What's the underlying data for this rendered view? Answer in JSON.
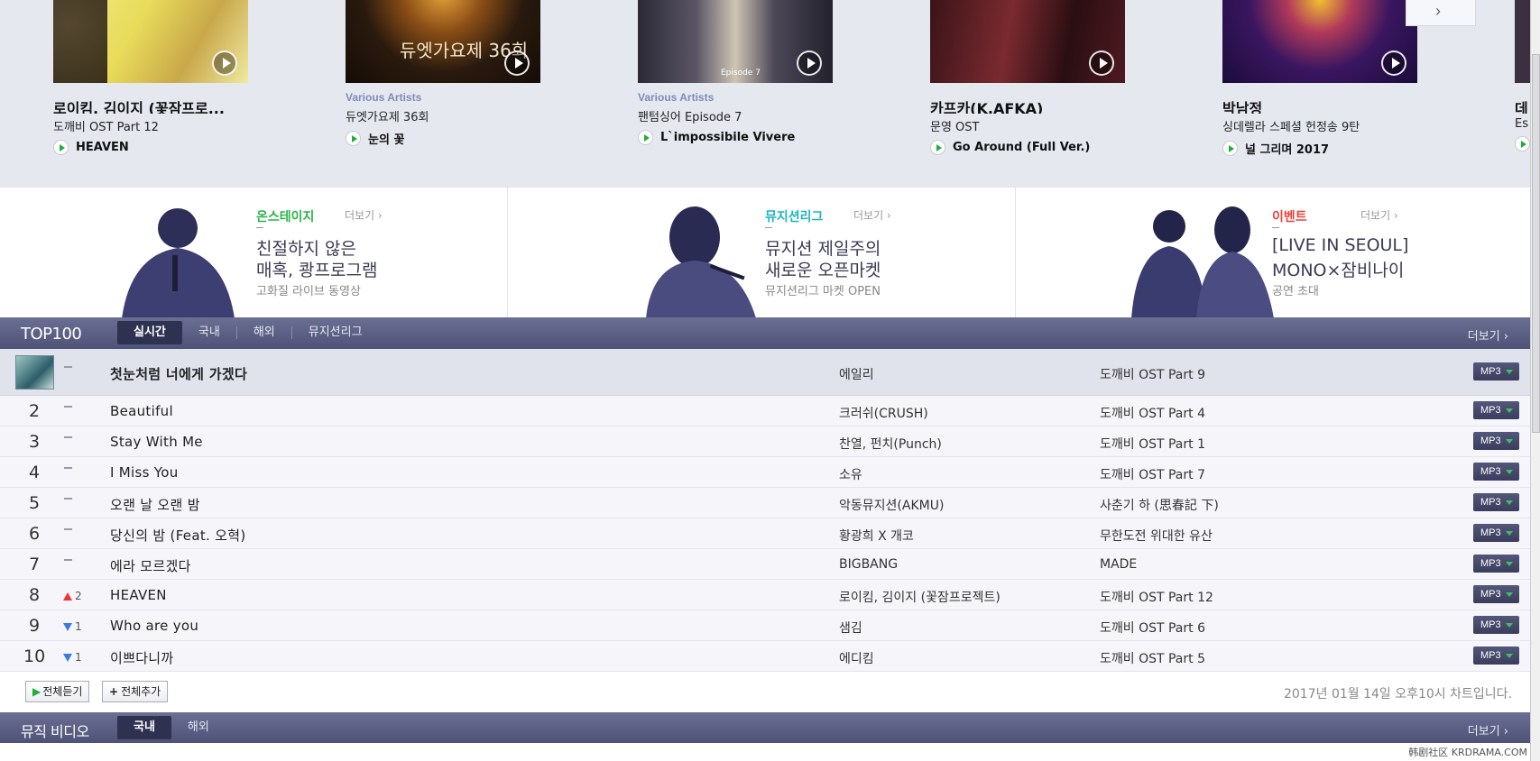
{
  "albums": [
    {
      "artist_small": "",
      "artist_big": "로이킴, 김이지 (꽃잠프로...",
      "sub": "도깨비 OST Part 12",
      "track": "HEAVEN",
      "cover_caption": ""
    },
    {
      "artist_small": "Various Artists",
      "artist_big": "",
      "sub": "듀엣가요제 36회",
      "track": "눈의 꽃",
      "cover_caption": "듀엣가요제 36회"
    },
    {
      "artist_small": "Various Artists",
      "artist_big": "",
      "sub": "팬텀싱어 Episode 7",
      "track": "L`impossibile Vivere",
      "cover_caption": "Episode 7"
    },
    {
      "artist_small": "",
      "artist_big": "카프카(K.AFKA)",
      "sub": "문영 OST",
      "track": "Go Around (Full Ver.)",
      "cover_caption": ""
    },
    {
      "artist_small": "",
      "artist_big": "박남정",
      "sub": "싱데렐라 스페셜 헌정송 9탄",
      "track": "널 그리며 2017",
      "cover_caption": ""
    },
    {
      "artist_small": "",
      "artist_big": "데",
      "sub": "Es",
      "track": "",
      "cover_caption": ""
    }
  ],
  "banners": [
    {
      "category": "온스테이지",
      "more": "더보기 ›",
      "line1": "친절하지 않은",
      "line2": "매혹, 쾅프로그램",
      "desc": "고화질 라이브 동영상",
      "color": "#2bb34a"
    },
    {
      "category": "뮤지션리그",
      "more": "더보기 ›",
      "line1": "뮤지션 제일주의",
      "line2": "새로운 오픈마켓",
      "desc": "뮤지션리그 마켓 OPEN",
      "color": "#1cb6c2"
    },
    {
      "category": "이벤트",
      "more": "더보기 ›",
      "line1": "[LIVE IN SEOUL]",
      "line2": "MONO×잠비나이",
      "desc": "공연 초대",
      "color": "#e8433c"
    }
  ],
  "top100": {
    "title": "TOP100",
    "tabs": [
      "실시간",
      "국내",
      "해외",
      "뮤지션리그"
    ],
    "active_tab": "실시간",
    "more": "더보기 ›"
  },
  "chart_rows": [
    {
      "rank": "",
      "change_type": "same",
      "change": "",
      "song": "첫눈처럼 너에게 가겠다",
      "artist": "에일리",
      "album": "도깨비 OST Part 9"
    },
    {
      "rank": "2",
      "change_type": "same",
      "change": "",
      "song": "Beautiful",
      "artist": "크러쉬(CRUSH)",
      "album": "도깨비 OST Part 4"
    },
    {
      "rank": "3",
      "change_type": "same",
      "change": "",
      "song": "Stay With Me",
      "artist": "찬열, 펀치(Punch)",
      "album": "도깨비 OST Part 1"
    },
    {
      "rank": "4",
      "change_type": "same",
      "change": "",
      "song": "I Miss You",
      "artist": "소유",
      "album": "도깨비 OST Part 7"
    },
    {
      "rank": "5",
      "change_type": "same",
      "change": "",
      "song": "오랜 날 오랜 밤",
      "artist": "악동뮤지션(AKMU)",
      "album": "사춘기 하 (思春記 下)"
    },
    {
      "rank": "6",
      "change_type": "same",
      "change": "",
      "song": "당신의 밤 (Feat. 오혁)",
      "artist": "황광희 X 개코",
      "album": "무한도전 위대한 유산"
    },
    {
      "rank": "7",
      "change_type": "same",
      "change": "",
      "song": "에라 모르겠다",
      "artist": "BIGBANG",
      "album": "MADE"
    },
    {
      "rank": "8",
      "change_type": "up",
      "change": "2",
      "song": "HEAVEN",
      "artist": "로이킴, 김이지 (꽃잠프로젝트)",
      "album": "도깨비 OST Part 12"
    },
    {
      "rank": "9",
      "change_type": "down",
      "change": "1",
      "song": "Who are you",
      "artist": "샘김",
      "album": "도깨비 OST Part 6"
    },
    {
      "rank": "10",
      "change_type": "down",
      "change": "1",
      "song": "이쁘다니까",
      "artist": "에디킴",
      "album": "도깨비 OST Part 5"
    }
  ],
  "mp3_label": "MP3",
  "footer": {
    "play_all": "전체듣기",
    "add_all": "전체추가",
    "chart_date": "2017년 01월 14일 오후10시 차트입니다."
  },
  "music_video": {
    "title": "뮤직 비디오",
    "tabs": [
      "국내",
      "해외"
    ],
    "active_tab": "국내",
    "more": "더보기 ›"
  },
  "watermark": "韩剧社区 KRDRAMA.COM"
}
